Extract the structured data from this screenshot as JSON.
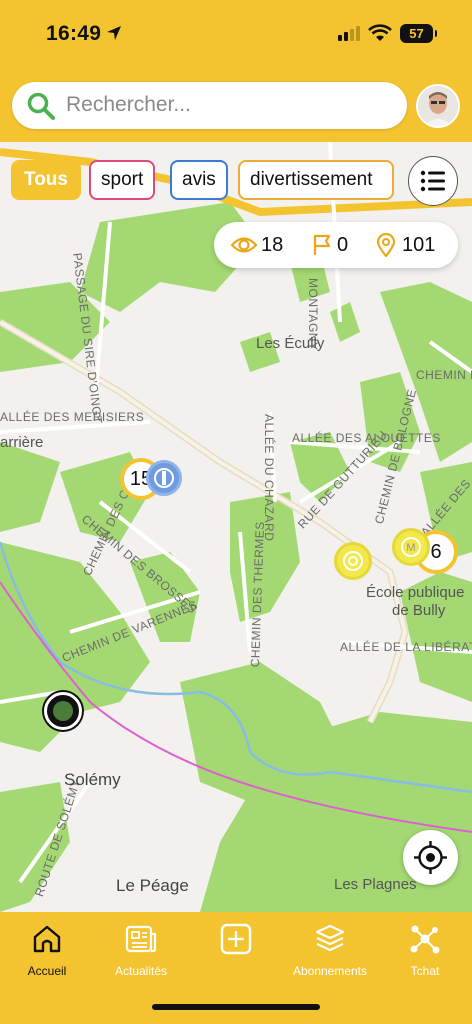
{
  "status_bar": {
    "time": "16:49",
    "battery": "57"
  },
  "search": {
    "placeholder": "Rechercher..."
  },
  "filters": [
    {
      "label": "Tous",
      "color": "#f4c430"
    },
    {
      "label": "sport",
      "color": "#e0497a"
    },
    {
      "label": "avis",
      "color": "#3b7bd4"
    },
    {
      "label": "divertissement",
      "color": "#f0a93b"
    }
  ],
  "stats": {
    "views": "18",
    "flags": "0",
    "places": "101"
  },
  "map": {
    "streets": [
      "PASSAGE DU SIRE D'OINGT",
      "ALLÉE DES MERISIERS",
      "ALLÉE DES ALOUETTES",
      "ALLÉE DU CHAZARD",
      "RUE DE GUTTURIEU",
      "CHEMIN DE BOLOGNE",
      "CHEMIN DES THERMES",
      "CHEMIN DES BROSSES",
      "CHEMIN DE VARENNES",
      "ALLÉE DE LA LIBÉRATION",
      "ROUTE DE SOLÉMY",
      "CHEMIN DE",
      "MONTAGNY",
      "CHEMIN DES CH",
      "ALLÉE DES",
      "ALLÉE DE"
    ],
    "places": [
      "Les Écully",
      "Solémy",
      "Le Péage",
      "Les Plagnes",
      "École publique",
      "de Bully",
      "arrière",
      "Bu",
      "lly"
    ]
  },
  "markers": {
    "cluster_left": "15",
    "cluster_right": "6"
  },
  "colors": {
    "accent": "#f4c430",
    "park": "#9ed46a"
  },
  "nav": [
    {
      "label": "Accueil",
      "icon": "home-icon"
    },
    {
      "label": "Actualités",
      "icon": "news-icon"
    },
    {
      "label": "",
      "icon": "add-icon"
    },
    {
      "label": "Abonnements",
      "icon": "layers-icon"
    },
    {
      "label": "Tchat",
      "icon": "network-icon"
    }
  ]
}
